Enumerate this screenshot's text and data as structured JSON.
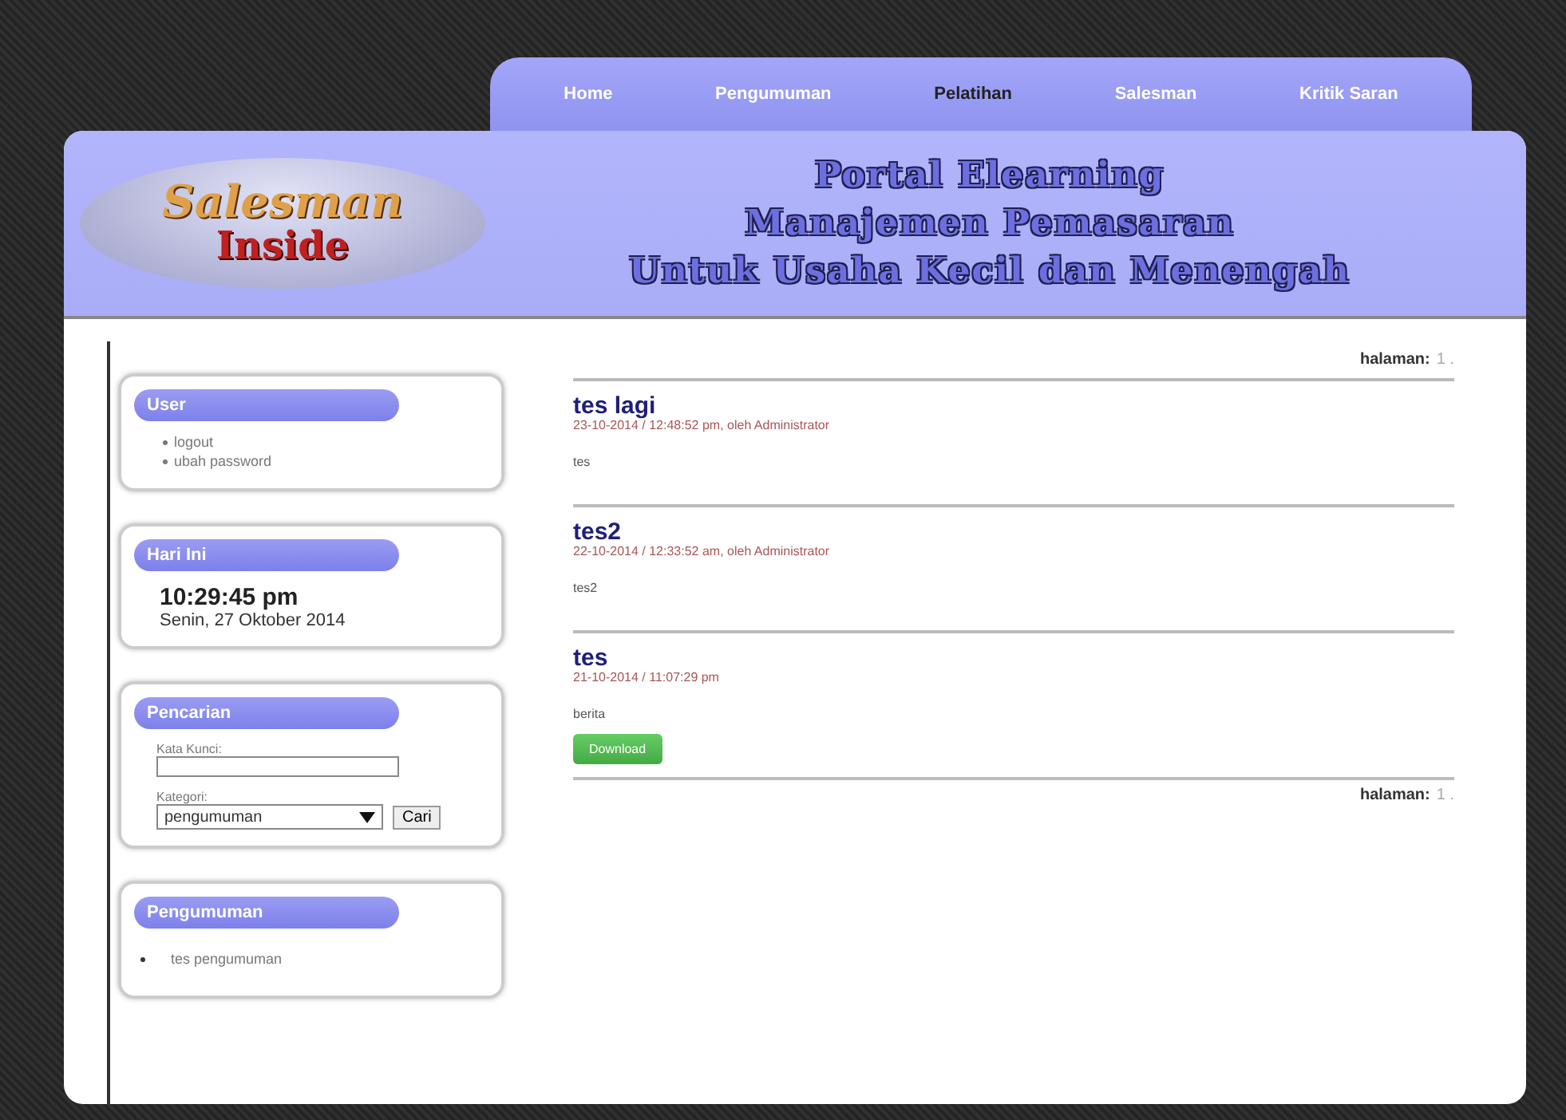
{
  "nav": [
    {
      "label": "Home",
      "selected": false
    },
    {
      "label": "Pengumuman",
      "selected": false
    },
    {
      "label": "Pelatihan",
      "selected": true
    },
    {
      "label": "Salesman",
      "selected": false
    },
    {
      "label": "Kritik Saran",
      "selected": false
    }
  ],
  "logo": {
    "line1": "Salesman",
    "line2": "Inside"
  },
  "header_lines": [
    "Portal Elearning",
    "Manajemen Pemasaran",
    "Untuk Usaha Kecil dan Menengah"
  ],
  "sidebar": [
    {
      "kind": "links",
      "title": "User",
      "items": [
        "logout",
        "ubah password"
      ]
    },
    {
      "kind": "clock",
      "title": "Hari Ini",
      "time": "10:29:45 pm",
      "date": "Senin, 27 Oktober 2014"
    },
    {
      "kind": "search",
      "title": "Pencarian",
      "keyword_label": "Kata Kunci:",
      "category_label": "Kategori:",
      "category_value": "pengumuman",
      "button": "Cari"
    },
    {
      "kind": "list",
      "title": "Pengumuman",
      "items": [
        "tes pengumuman"
      ]
    }
  ],
  "pagination_top": {
    "label": "halaman:",
    "pages": "1 ."
  },
  "posts": [
    {
      "title": "tes lagi",
      "meta": "23-10-2014 / 12:48:52 pm, oleh Administrator",
      "body": "tes"
    },
    {
      "title": "tes2",
      "meta": "22-10-2014 / 12:33:52 am, oleh Administrator",
      "body": "tes2"
    },
    {
      "title": "tes",
      "meta": "21-10-2014 / 11:07:29 pm",
      "body": "berita",
      "download": "Download"
    }
  ],
  "pagination_bottom": {
    "label": "halaman:",
    "pages": "1 ."
  }
}
